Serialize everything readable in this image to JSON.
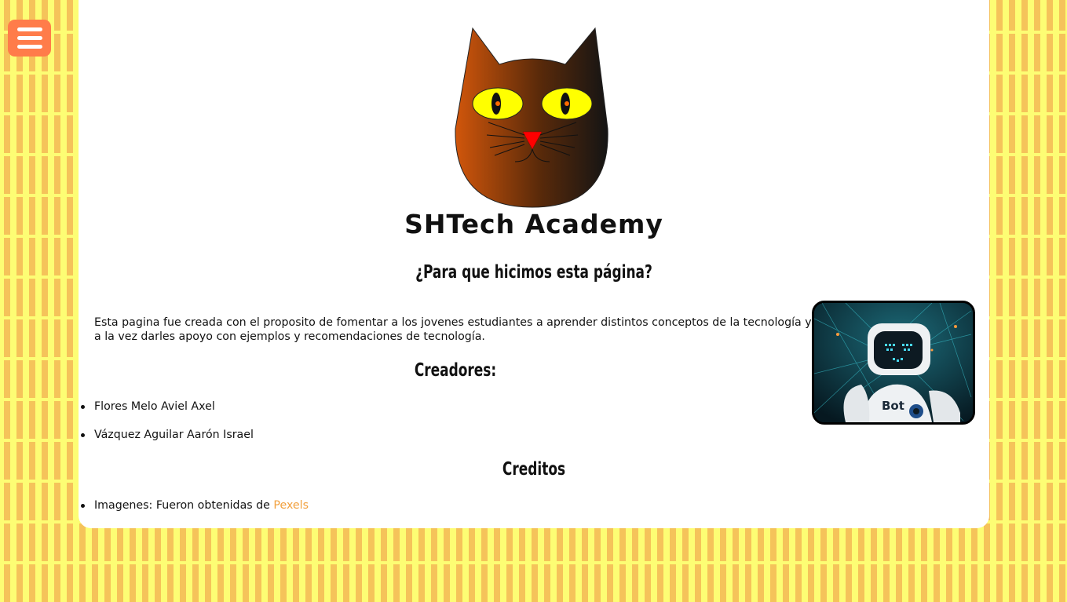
{
  "header": {
    "menu_icon": "hamburger-menu-icon",
    "logo_icon": "cat-face-logo-icon",
    "site_title": "SHTech Academy"
  },
  "about": {
    "heading": "¿Para que hicimos esta página?",
    "paragraph": "Esta pagina fue creada con el proposito de fomentar a los jovenes estudiantes a aprender distintos conceptos de la tecnología y a la vez darles apoyo con ejemplos y recomendaciones de tecnología.",
    "image_icon": "robot-photo-icon",
    "image_label": "Bot"
  },
  "creators": {
    "heading": "Creadores:",
    "names": [
      "Flores Melo Aviel Axel",
      "Vázquez Aguilar Aarón Israel"
    ]
  },
  "credits": {
    "heading": "Creditos",
    "items": [
      {
        "label": "Imagenes:",
        "text": "Fueron obtenidas de",
        "link": "Pexels"
      }
    ]
  },
  "colors": {
    "background": "#fdfd74",
    "stripes": "#f5c35a",
    "menu_button": "#ff7c4a",
    "link": "#f2a03d",
    "card": "#ffffff"
  }
}
